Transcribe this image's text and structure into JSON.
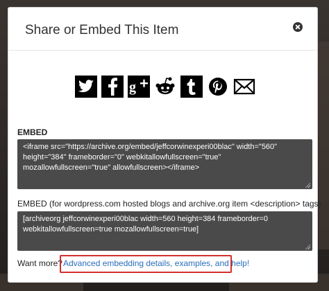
{
  "modal": {
    "title": "Share or Embed This Item"
  },
  "social": [
    {
      "icon": "twitter-icon"
    },
    {
      "icon": "facebook-icon"
    },
    {
      "icon": "google-plus-icon"
    },
    {
      "icon": "reddit-icon"
    },
    {
      "icon": "tumblr-icon"
    },
    {
      "icon": "pinterest-icon"
    },
    {
      "icon": "email-icon"
    }
  ],
  "embed": {
    "label": "EMBED",
    "code": "<iframe src=\"https://archive.org/embed/jeffcorwinexperi00blac\" width=\"560\" height=\"384\" frameborder=\"0\" webkitallowfullscreen=\"true\" mozallowfullscreen=\"true\" allowfullscreen></iframe>"
  },
  "embed_wp": {
    "label": "EMBED (for wordpress.com hosted blogs and archive.org item <description> tags)",
    "code": "[archiveorg jeffcorwinexperi00blac width=560 height=384 frameborder=0 webkitallowfullscreen=true mozallowfullscreen=true]"
  },
  "footer": {
    "prompt": "Want more?",
    "link": "Advanced embedding details, examples, and help!"
  },
  "colors": {
    "link": "#2a6ebb",
    "highlight_border": "#d32f2f",
    "code_bg": "#4a4a4a"
  }
}
